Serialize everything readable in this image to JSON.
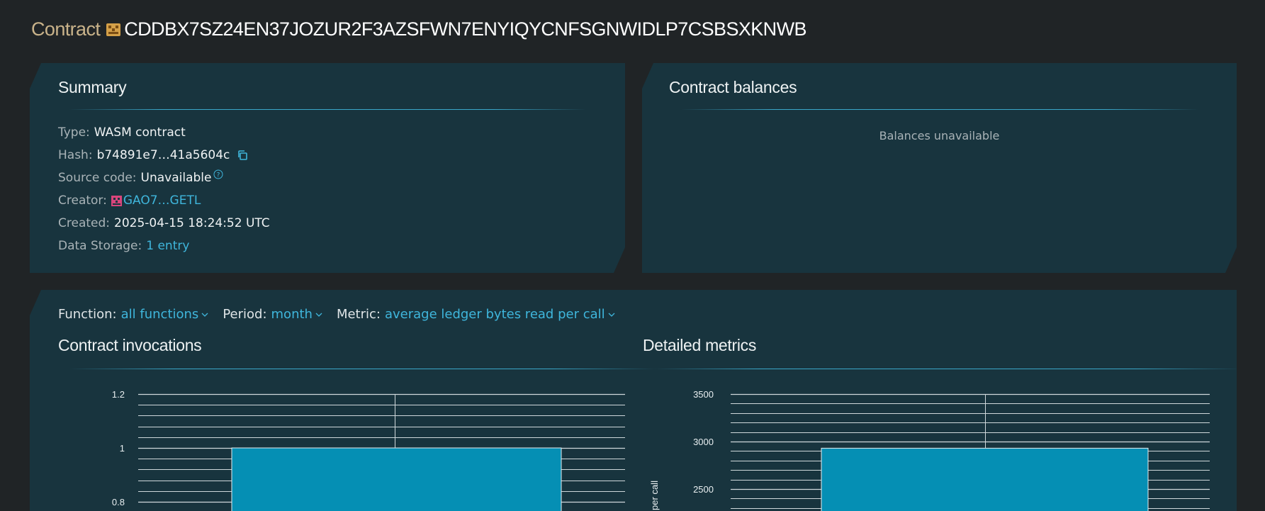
{
  "page": {
    "prefix": "Contract",
    "address": "CDDBX7SZ24EN37JOZUR2F3AZSFWN7ENYIQYCNFSGNWIDLP7CSBSXKNWB",
    "icon": "contract-avatar-icon"
  },
  "summary": {
    "title": "Summary",
    "type": {
      "label": "Type:",
      "value": "WASM contract"
    },
    "hash": {
      "label": "Hash:",
      "value": "b74891e7…41a5604c",
      "icon": "copy-icon"
    },
    "source": {
      "label": "Source code:",
      "value": "Unavailable",
      "icon": "help-icon"
    },
    "creator": {
      "label": "Creator:",
      "value": "GAO7…GETL",
      "icon": "account-avatar-icon"
    },
    "created": {
      "label": "Created:",
      "value": "2025-04-15 18:24:52 UTC"
    },
    "storage": {
      "label": "Data Storage:",
      "value": "1 entry"
    }
  },
  "balances": {
    "title": "Contract balances",
    "empty": "Balances unavailable"
  },
  "filters": {
    "function": {
      "label": "Function:",
      "value": "all functions"
    },
    "period": {
      "label": "Period:",
      "value": "month"
    },
    "metric": {
      "label": "Metric:",
      "value": "average ledger bytes read per call"
    }
  },
  "colors": {
    "accent": "#3fb6dc",
    "bar": "#058fb4",
    "card": "#18343e",
    "background": "#202426"
  },
  "chart_data": [
    {
      "type": "bar",
      "title": "Contract invocations",
      "categories": [
        ""
      ],
      "values": [
        1
      ],
      "ylim": [
        0.75,
        1.2
      ],
      "yticks": [
        0.8,
        1,
        1.2
      ],
      "ylabel": "",
      "grid": true
    },
    {
      "type": "bar",
      "title": "Detailed metrics",
      "categories": [
        ""
      ],
      "values": [
        2930
      ],
      "ylim": [
        2200,
        3500
      ],
      "yticks": [
        2500,
        3000,
        3500
      ],
      "ylabel": "per call",
      "grid": true
    }
  ]
}
